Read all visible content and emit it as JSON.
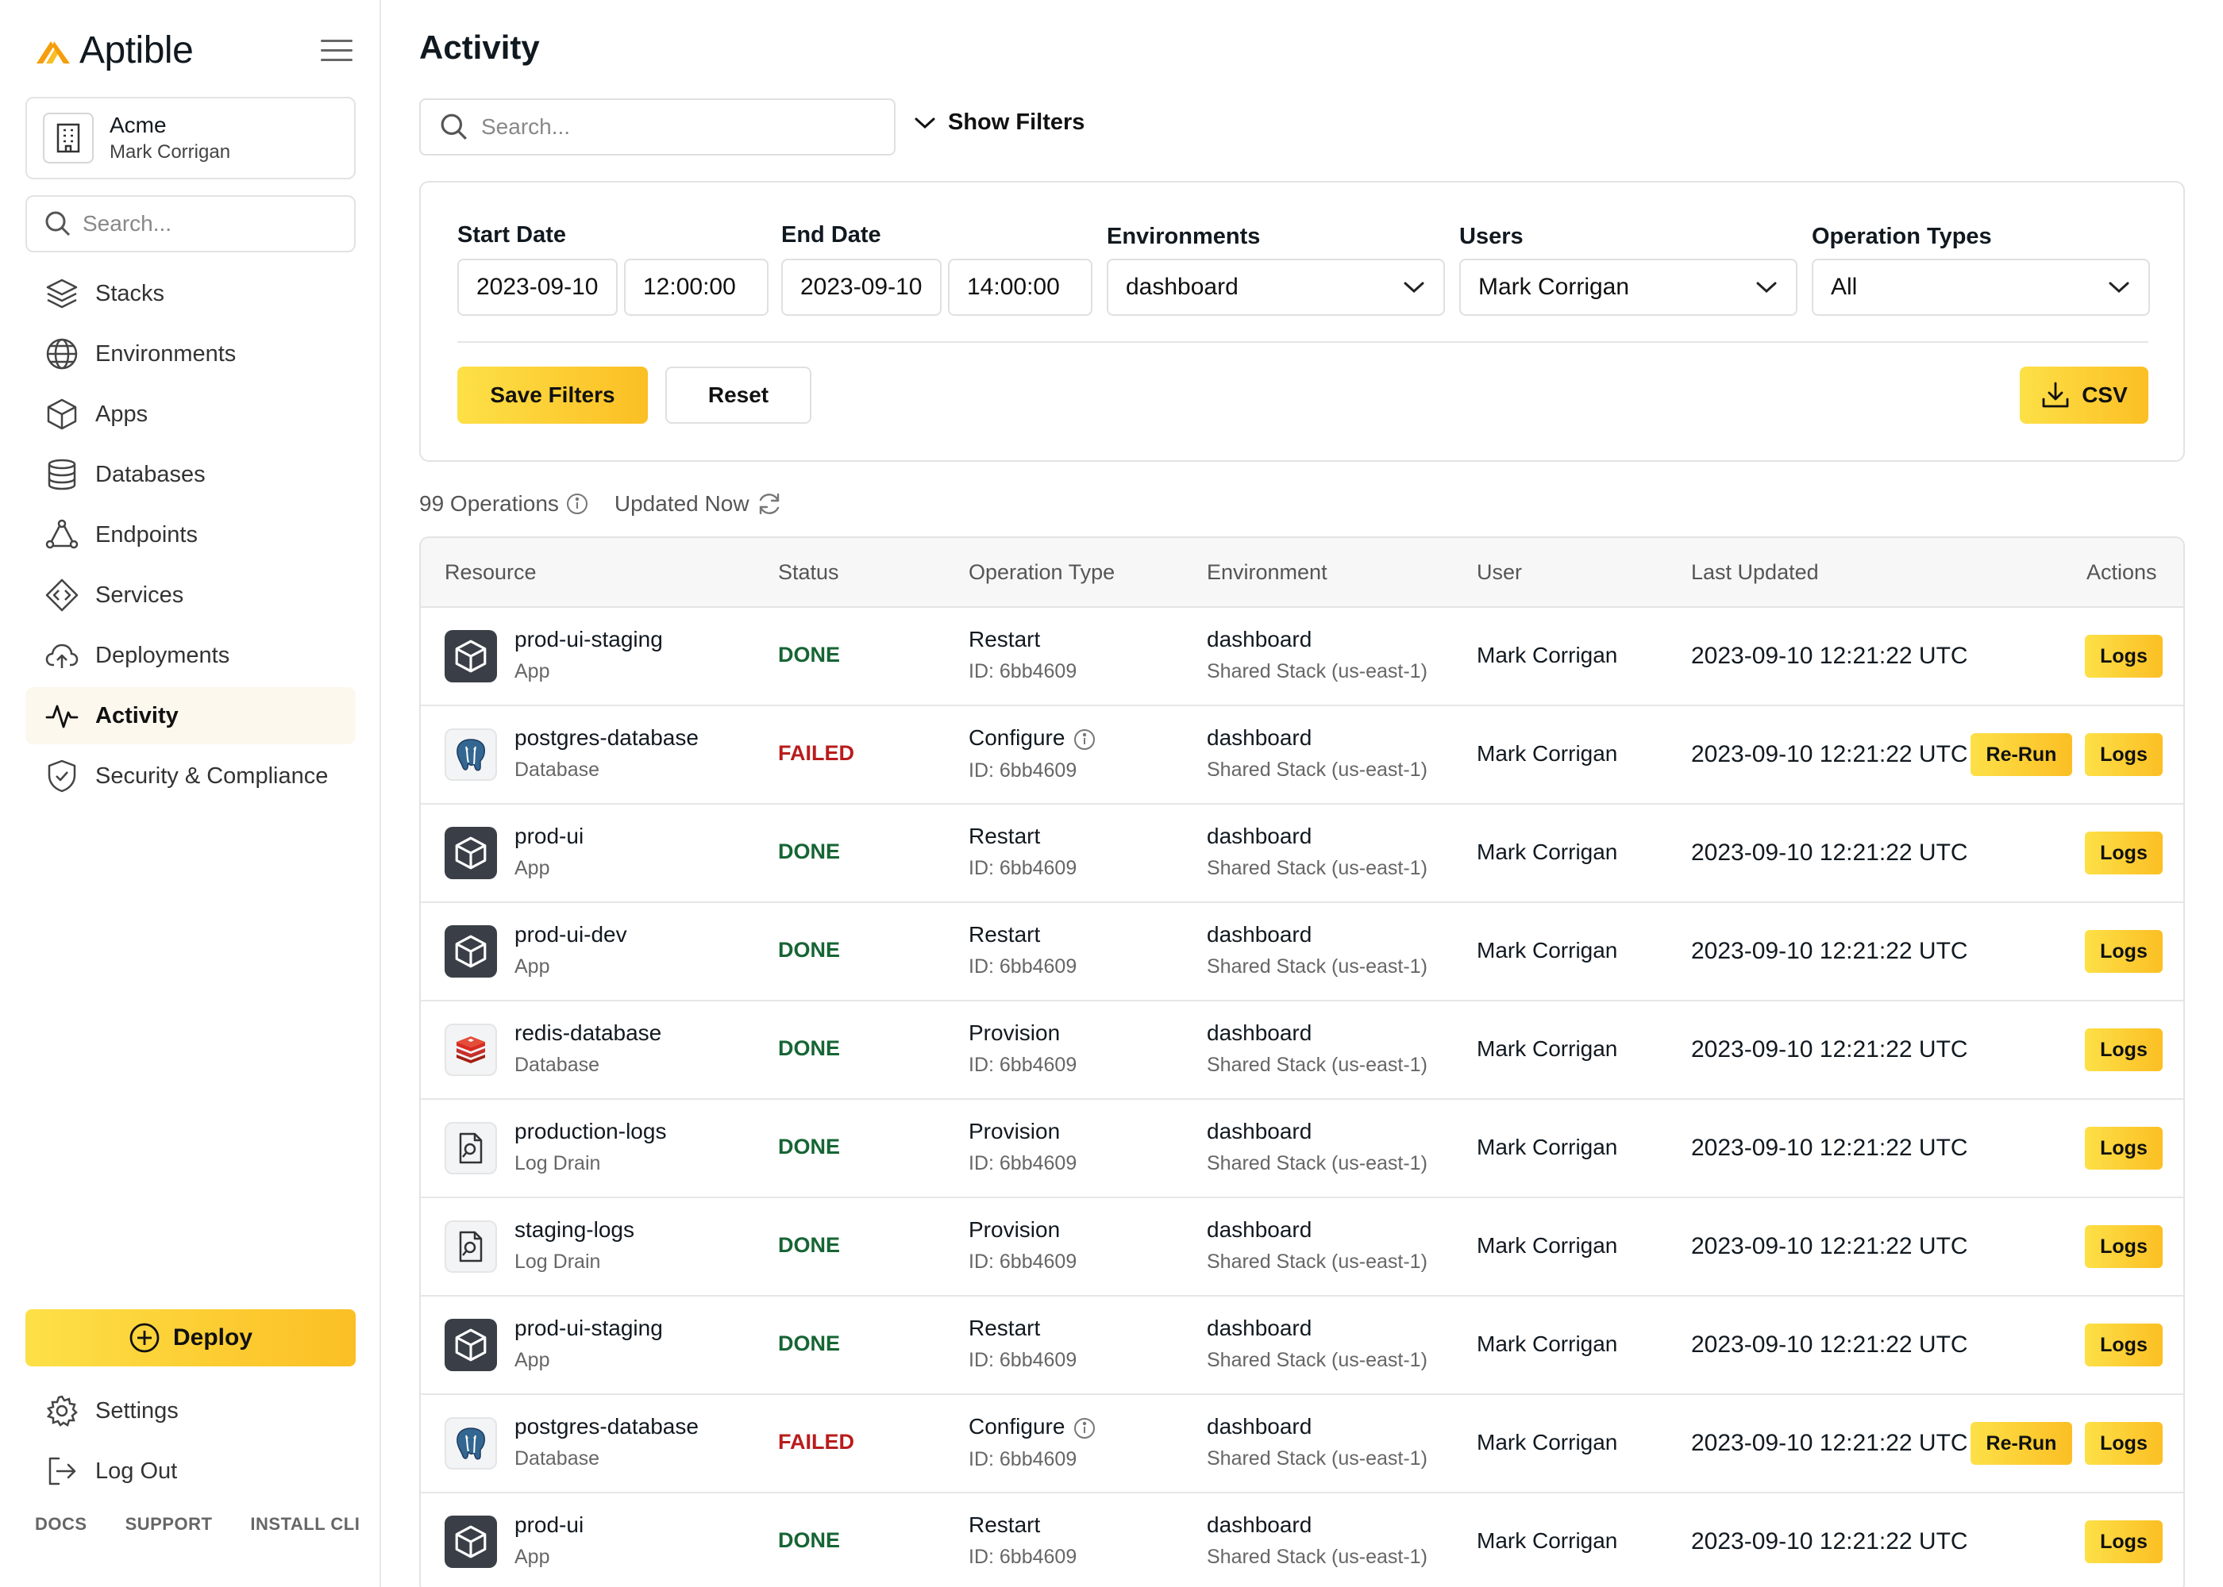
{
  "brand": {
    "name": "Aptible",
    "accent": "#fbbf24",
    "accent_light": "#fde047"
  },
  "org": {
    "name": "Acme",
    "user": "Mark Corrigan"
  },
  "sidebar": {
    "search_placeholder": "Search...",
    "items": [
      {
        "label": "Stacks",
        "icon": "layers-icon"
      },
      {
        "label": "Environments",
        "icon": "globe-icon"
      },
      {
        "label": "Apps",
        "icon": "cube-icon"
      },
      {
        "label": "Databases",
        "icon": "database-icon"
      },
      {
        "label": "Endpoints",
        "icon": "endpoints-icon"
      },
      {
        "label": "Services",
        "icon": "code-diamond-icon"
      },
      {
        "label": "Deployments",
        "icon": "cloud-upload-icon"
      },
      {
        "label": "Activity",
        "icon": "activity-icon",
        "active": true
      },
      {
        "label": "Security & Compliance",
        "icon": "shield-check-icon"
      }
    ],
    "deploy_label": "Deploy",
    "bottom_items": [
      {
        "label": "Settings",
        "icon": "gear-icon"
      },
      {
        "label": "Log Out",
        "icon": "logout-icon"
      }
    ],
    "footer_links": [
      "DOCS",
      "SUPPORT",
      "INSTALL CLI"
    ]
  },
  "main": {
    "title": "Activity",
    "search_placeholder": "Search...",
    "show_filters_label": "Show Filters"
  },
  "filters": {
    "start_label": "Start Date",
    "start_date": "2023-09-10",
    "start_time": "12:00:00",
    "end_label": "End Date",
    "end_date": "2023-09-10",
    "end_time": "14:00:00",
    "env_label": "Environments",
    "env_value": "dashboard",
    "users_label": "Users",
    "users_value": "Mark Corrigan",
    "optypes_label": "Operation Types",
    "optypes_value": "All",
    "save_label": "Save Filters",
    "reset_label": "Reset",
    "csv_label": "CSV"
  },
  "summary": {
    "count": "99 Operations",
    "updated": "Updated Now"
  },
  "table": {
    "headers": [
      "Resource",
      "Status",
      "Operation Type",
      "Environment",
      "User",
      "Last Updated",
      "Actions"
    ],
    "rerun_label": "Re-Run",
    "logs_label": "Logs",
    "rows": [
      {
        "name": "prod-ui-staging",
        "type": "App",
        "icon": "app",
        "status": "DONE",
        "op": "Restart",
        "op_id": "ID: 6bb4609",
        "env": "dashboard",
        "stack": "Shared Stack (us-east-1)",
        "user": "Mark Corrigan",
        "updated": "2023-09-10 12:21:22 UTC",
        "rerun": false,
        "info": false
      },
      {
        "name": "postgres-database",
        "type": "Database",
        "icon": "postgres",
        "status": "FAILED",
        "op": "Configure",
        "op_id": "ID: 6bb4609",
        "env": "dashboard",
        "stack": "Shared Stack (us-east-1)",
        "user": "Mark Corrigan",
        "updated": "2023-09-10 12:21:22 UTC",
        "rerun": true,
        "info": true
      },
      {
        "name": "prod-ui",
        "type": "App",
        "icon": "app",
        "status": "DONE",
        "op": "Restart",
        "op_id": "ID: 6bb4609",
        "env": "dashboard",
        "stack": "Shared Stack (us-east-1)",
        "user": "Mark Corrigan",
        "updated": "2023-09-10 12:21:22 UTC",
        "rerun": false,
        "info": false
      },
      {
        "name": "prod-ui-dev",
        "type": "App",
        "icon": "app",
        "status": "DONE",
        "op": "Restart",
        "op_id": "ID: 6bb4609",
        "env": "dashboard",
        "stack": "Shared Stack (us-east-1)",
        "user": "Mark Corrigan",
        "updated": "2023-09-10 12:21:22 UTC",
        "rerun": false,
        "info": false
      },
      {
        "name": "redis-database",
        "type": "Database",
        "icon": "redis",
        "status": "DONE",
        "op": "Provision",
        "op_id": "ID: 6bb4609",
        "env": "dashboard",
        "stack": "Shared Stack (us-east-1)",
        "user": "Mark Corrigan",
        "updated": "2023-09-10 12:21:22 UTC",
        "rerun": false,
        "info": false
      },
      {
        "name": "production-logs",
        "type": "Log Drain",
        "icon": "logdrain",
        "status": "DONE",
        "op": "Provision",
        "op_id": "ID: 6bb4609",
        "env": "dashboard",
        "stack": "Shared Stack (us-east-1)",
        "user": "Mark Corrigan",
        "updated": "2023-09-10 12:21:22 UTC",
        "rerun": false,
        "info": false
      },
      {
        "name": "staging-logs",
        "type": "Log Drain",
        "icon": "logdrain",
        "status": "DONE",
        "op": "Provision",
        "op_id": "ID: 6bb4609",
        "env": "dashboard",
        "stack": "Shared Stack (us-east-1)",
        "user": "Mark Corrigan",
        "updated": "2023-09-10 12:21:22 UTC",
        "rerun": false,
        "info": false
      },
      {
        "name": "prod-ui-staging",
        "type": "App",
        "icon": "app",
        "status": "DONE",
        "op": "Restart",
        "op_id": "ID: 6bb4609",
        "env": "dashboard",
        "stack": "Shared Stack (us-east-1)",
        "user": "Mark Corrigan",
        "updated": "2023-09-10 12:21:22 UTC",
        "rerun": false,
        "info": false
      },
      {
        "name": "postgres-database",
        "type": "Database",
        "icon": "postgres",
        "status": "FAILED",
        "op": "Configure",
        "op_id": "ID: 6bb4609",
        "env": "dashboard",
        "stack": "Shared Stack (us-east-1)",
        "user": "Mark Corrigan",
        "updated": "2023-09-10 12:21:22 UTC",
        "rerun": true,
        "info": true
      },
      {
        "name": "prod-ui",
        "type": "App",
        "icon": "app",
        "status": "DONE",
        "op": "Restart",
        "op_id": "ID: 6bb4609",
        "env": "dashboard",
        "stack": "Shared Stack (us-east-1)",
        "user": "Mark Corrigan",
        "updated": "2023-09-10 12:21:22 UTC",
        "rerun": false,
        "info": false
      }
    ]
  }
}
